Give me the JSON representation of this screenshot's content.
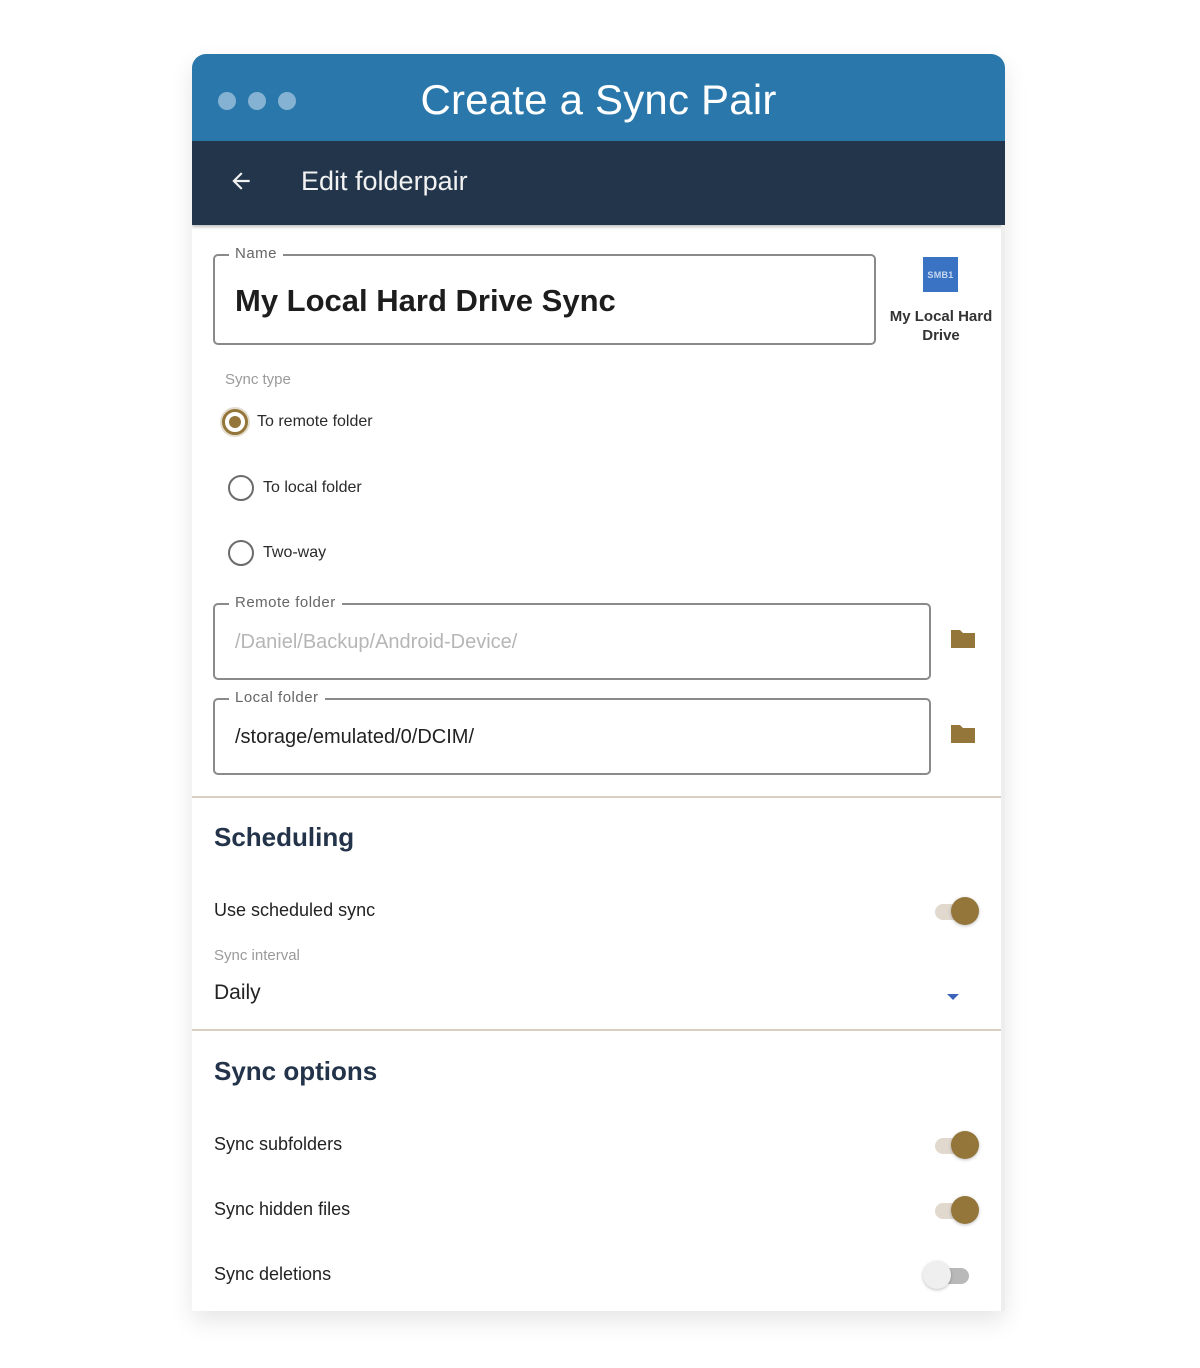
{
  "window": {
    "title": "Create a Sync Pair",
    "dots": [
      "dot-1",
      "dot-2",
      "dot-3"
    ],
    "colors": {
      "titlebar": "#2a78ab",
      "appbar": "#22354b",
      "accent": "#94763a"
    }
  },
  "appbar": {
    "back_icon": "arrow-left-icon",
    "title": "Edit folderpair"
  },
  "name_field": {
    "label": "Name",
    "value": "My Local Hard Drive Sync"
  },
  "account": {
    "badge": "SMB1",
    "label": "My Local Hard Drive"
  },
  "sync_type": {
    "caption": "Sync type",
    "selected": "To remote folder",
    "options": [
      {
        "label": "To remote folder",
        "checked": true
      },
      {
        "label": "To local folder",
        "checked": false
      },
      {
        "label": "Two-way",
        "checked": false
      }
    ]
  },
  "remote_folder": {
    "label": "Remote folder",
    "placeholder": "/Daniel/Backup/Android-Device/",
    "icon": "folder-icon"
  },
  "local_folder": {
    "label": "Local folder",
    "value": "/storage/emulated/0/DCIM/",
    "icon": "folder-icon"
  },
  "scheduling": {
    "title": "Scheduling",
    "use_scheduled_sync": {
      "label": "Use scheduled sync",
      "on": true
    },
    "interval_caption": "Sync interval",
    "interval_value": "Daily"
  },
  "sync_options": {
    "title": "Sync options",
    "items": [
      {
        "label": "Sync subfolders",
        "on": true
      },
      {
        "label": "Sync hidden files",
        "on": true
      },
      {
        "label": "Sync deletions",
        "on": false
      }
    ]
  }
}
